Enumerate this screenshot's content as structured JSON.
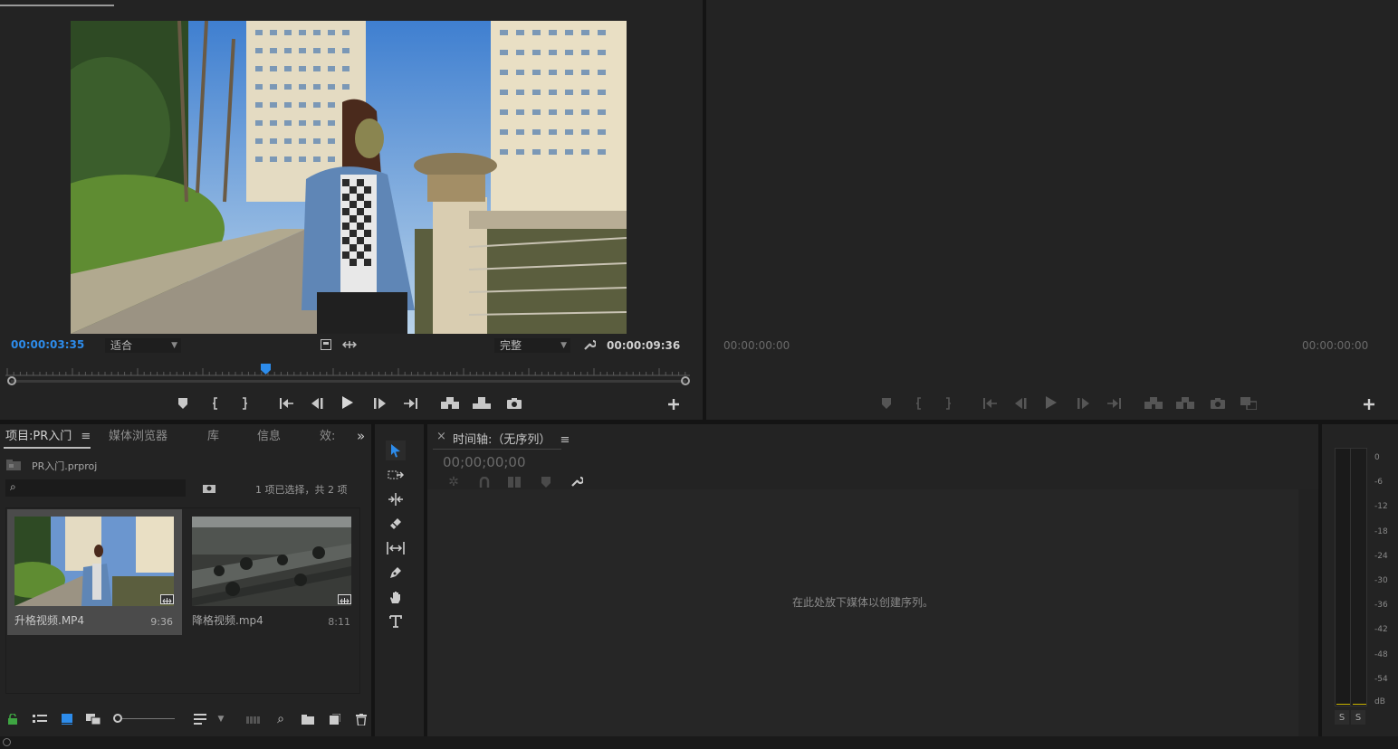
{
  "source_monitor": {
    "top_tabs": [
      "",
      "",
      "",
      ""
    ],
    "current_timecode": "00:00:03:35",
    "fit_dropdown": "适合",
    "quality_dropdown": "完整",
    "duration_timecode": "00:00:09:36",
    "playhead_fraction": 0.38
  },
  "program_monitor": {
    "left_timecode": "00:00:00:00",
    "right_timecode": "00:00:00:00"
  },
  "project_panel": {
    "tabs": [
      "项目:PR入门",
      "媒体浏览器",
      "库",
      "信息",
      "效:"
    ],
    "overflow": "»",
    "project_file": "PR入门.prproj",
    "search_placeholder": "",
    "selection_status": "1 项已选择，共 2 项",
    "items": [
      {
        "name": "升格视频.MP4",
        "duration": "9:36"
      },
      {
        "name": "降格视频.mp4",
        "duration": "8:11"
      }
    ]
  },
  "timeline": {
    "close": "×",
    "title": "时间轴:（无序列）",
    "timecode": "00;00;00;00",
    "drop_hint": "在此处放下媒体以创建序列。"
  },
  "audio_meter": {
    "scale": [
      "0",
      "-6",
      "-12",
      "-18",
      "-24",
      "-30",
      "-36",
      "-42",
      "-48",
      "-54",
      "dB"
    ],
    "solo_left": "S",
    "solo_right": "S"
  },
  "colors": {
    "accent_blue": "#2d8ceb",
    "panel_bg": "#232323",
    "divider": "#141414"
  },
  "icons": {
    "marker": "marker-icon",
    "in_point": "in-point-icon",
    "out_point": "out-point-icon",
    "go_to_in": "go-to-in-icon",
    "step_back": "step-back-icon",
    "play": "play-icon",
    "step_forward": "step-forward-icon",
    "go_to_out": "go-to-out-icon",
    "insert": "insert-icon",
    "overwrite": "overwrite-icon",
    "export_frame": "camera-icon",
    "add": "plus-icon"
  }
}
